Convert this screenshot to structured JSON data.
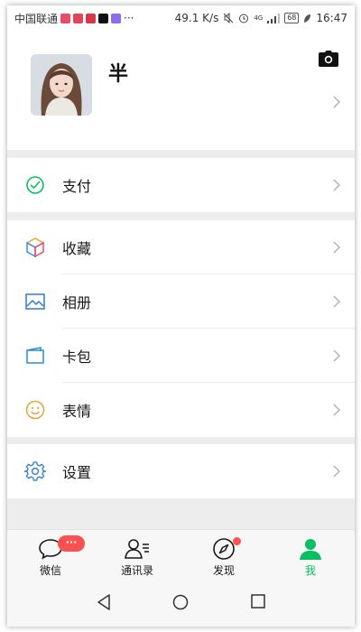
{
  "status_bar": {
    "carrier": "中国联通",
    "more": "···",
    "speed": "49.1 K/s",
    "network": "4G",
    "battery": "68",
    "time": "16:47"
  },
  "profile": {
    "name": "半"
  },
  "menu": {
    "pay": "支付",
    "favorites": "收藏",
    "album": "相册",
    "cards": "卡包",
    "stickers": "表情",
    "settings": "设置"
  },
  "tabs": {
    "chats": "微信",
    "contacts": "通讯录",
    "discover": "发现",
    "me": "我",
    "chats_badge": "···"
  },
  "colors": {
    "accent": "#07c160",
    "badge": "#fa5151",
    "page_bg": "#ededed"
  }
}
